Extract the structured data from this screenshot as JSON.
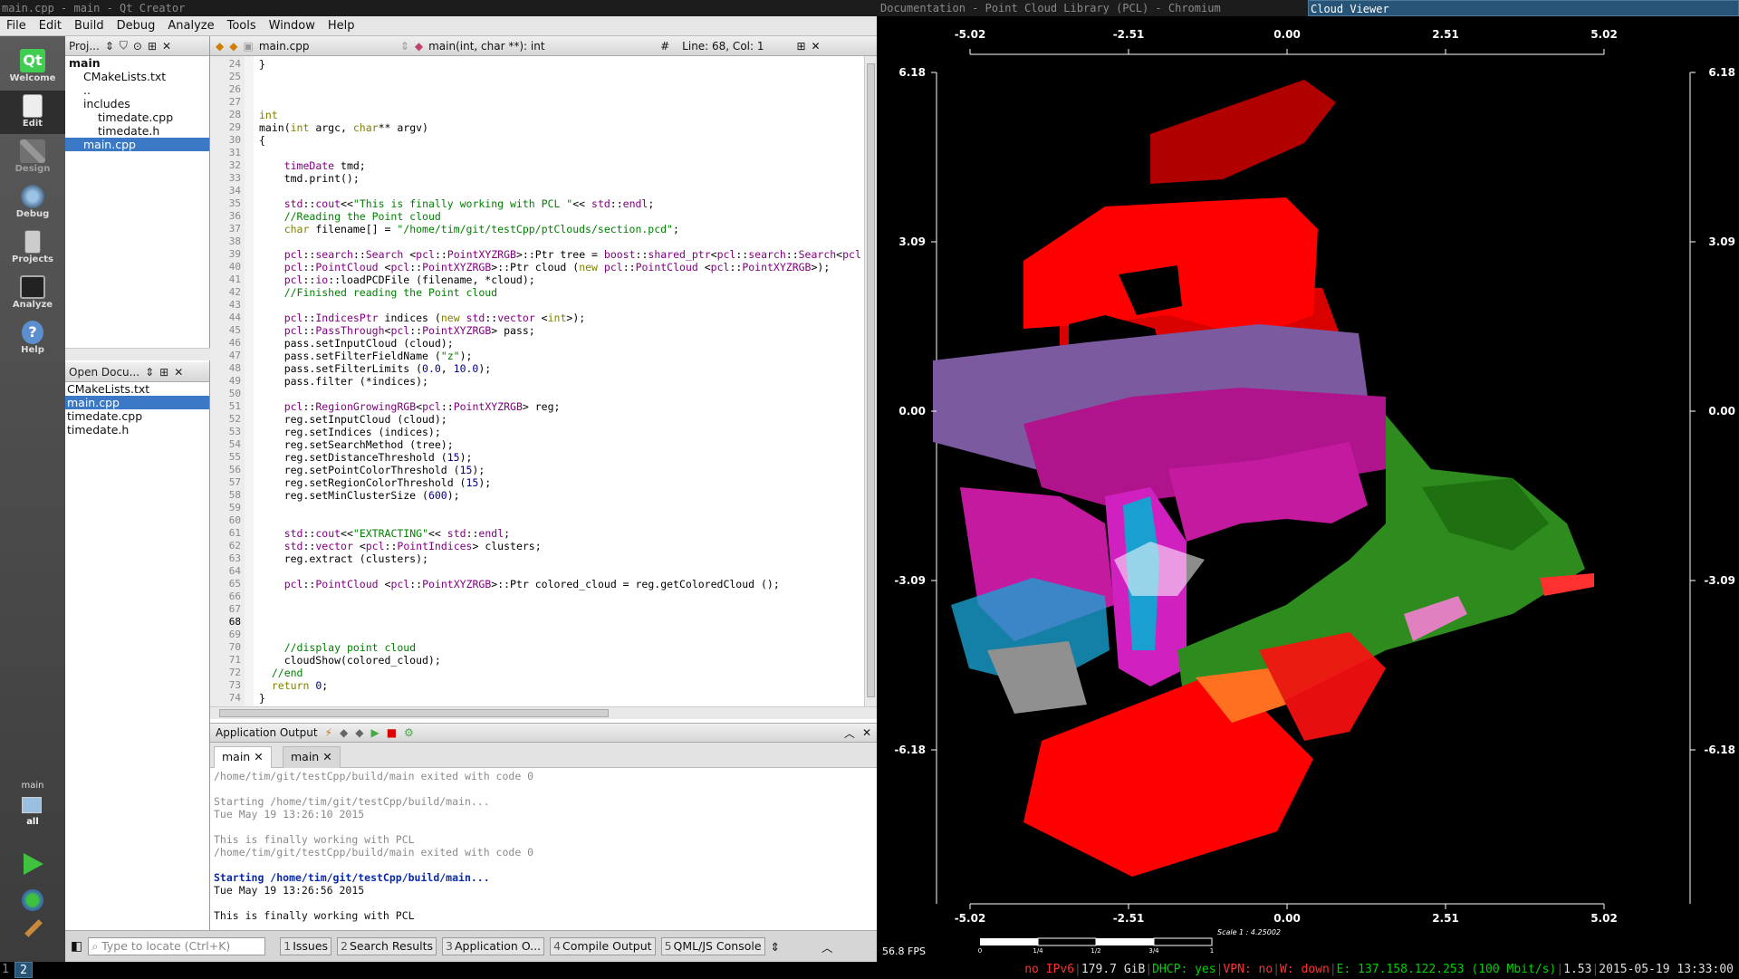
{
  "wm": {
    "title_qt": "main.cpp - main - Qt Creator",
    "title_chromium": "Documentation - Point Cloud Library (PCL) - Chromium",
    "title_viewer": "Cloud Viewer"
  },
  "menu": [
    "File",
    "Edit",
    "Build",
    "Debug",
    "Analyze",
    "Tools",
    "Window",
    "Help"
  ],
  "modes": [
    "Welcome",
    "Edit",
    "Design",
    "Debug",
    "Projects",
    "Analyze",
    "Help"
  ],
  "kit": {
    "project": "main",
    "build": "all"
  },
  "project_pane": {
    "title": "Proj...",
    "tree": [
      {
        "label": "main",
        "depth": 0,
        "bold": true
      },
      {
        "label": "CMakeLists.txt",
        "depth": 1
      },
      {
        "label": "..",
        "depth": 1
      },
      {
        "label": "includes",
        "depth": 1
      },
      {
        "label": "timedate.cpp",
        "depth": 2
      },
      {
        "label": "timedate.h",
        "depth": 2
      },
      {
        "label": "main.cpp",
        "depth": 1,
        "selected": true
      }
    ]
  },
  "open_docs": {
    "title": "Open Docu...",
    "items": [
      "CMakeLists.txt",
      "main.cpp",
      "timedate.cpp",
      "timedate.h"
    ],
    "selected": 1
  },
  "editor": {
    "file": "main.cpp",
    "symbol": "main(int, char **): int",
    "hash": "#",
    "position": "Line: 68, Col: 1",
    "line_numbers": [
      "24",
      "25",
      "26",
      "27",
      "28",
      "29",
      "30",
      "31",
      "32",
      "33",
      "34",
      "35",
      "36",
      "37",
      "38",
      "39",
      "40",
      "41",
      "42",
      "43",
      "44",
      "45",
      "46",
      "47",
      "48",
      "49",
      "50",
      "51",
      "52",
      "53",
      "54",
      "55",
      "56",
      "57",
      "58",
      "59",
      "60",
      "61",
      "62",
      "63",
      "64",
      "65",
      "66",
      "67",
      "68",
      "69",
      "70",
      "71",
      "72",
      "73",
      "74"
    ],
    "lines": [
      "}",
      "",
      "",
      "",
      "int",
      "main(int argc, char** argv)",
      "{",
      "",
      "    timeDate tmd;",
      "    tmd.print();",
      "",
      "    std::cout<<\"This is finally working with PCL \"<< std::endl;",
      "    //Reading the Point cloud",
      "    char filename[] = \"/home/tim/git/testCpp/ptClouds/section.pcd\";",
      "",
      "    pcl::search::Search <pcl::PointXYZRGB>::Ptr tree = boost::shared_ptr<pcl::search::Search<pcl",
      "    pcl::PointCloud <pcl::PointXYZRGB>::Ptr cloud (new pcl::PointCloud <pcl::PointXYZRGB>);",
      "    pcl::io::loadPCDFile (filename, *cloud);",
      "    //Finished reading the Point cloud",
      "",
      "    pcl::IndicesPtr indices (new std::vector <int>);",
      "    pcl::PassThrough<pcl::PointXYZRGB> pass;",
      "    pass.setInputCloud (cloud);",
      "    pass.setFilterFieldName (\"z\");",
      "    pass.setFilterLimits (0.0, 10.0);",
      "    pass.filter (*indices);",
      "",
      "    pcl::RegionGrowingRGB<pcl::PointXYZRGB> reg;",
      "    reg.setInputCloud (cloud);",
      "    reg.setIndices (indices);",
      "    reg.setSearchMethod (tree);",
      "    reg.setDistanceThreshold (15);",
      "    reg.setPointColorThreshold (15);",
      "    reg.setRegionColorThreshold (15);",
      "    reg.setMinClusterSize (600);",
      "",
      "",
      "    std::cout<<\"EXTRACTING\"<< std::endl;",
      "    std::vector <pcl::PointIndices> clusters;",
      "    reg.extract (clusters);",
      "",
      "    pcl::PointCloud <pcl::PointXYZRGB>::Ptr colored_cloud = reg.getColoredCloud ();",
      "",
      "",
      "",
      "",
      "    //display point cloud",
      "    cloudShow(colored_cloud);",
      "  //end",
      "  return 0;",
      "}"
    ]
  },
  "output_pane": {
    "title": "Application Output",
    "tabs": [
      "main",
      "main"
    ],
    "lines": [
      {
        "t": "/home/tim/git/testCpp/build/main exited with code 0",
        "c": "gray"
      },
      {
        "t": "",
        "c": ""
      },
      {
        "t": "Starting /home/tim/git/testCpp/build/main...",
        "c": "gray"
      },
      {
        "t": "Tue May 19 13:26:10 2015",
        "c": "gray"
      },
      {
        "t": "",
        "c": ""
      },
      {
        "t": "This is finally working with PCL",
        "c": "gray"
      },
      {
        "t": "/home/tim/git/testCpp/build/main exited with code 0",
        "c": "gray"
      },
      {
        "t": "",
        "c": ""
      },
      {
        "t": "Starting /home/tim/git/testCpp/build/main...",
        "c": "blue"
      },
      {
        "t": "Tue May 19 13:26:56 2015",
        "c": ""
      },
      {
        "t": "",
        "c": ""
      },
      {
        "t": "This is finally working with PCL",
        "c": ""
      }
    ]
  },
  "statusbar": {
    "locator_placeholder": "Type to locate (Ctrl+K)",
    "panes": [
      {
        "n": "1",
        "label": "Issues"
      },
      {
        "n": "2",
        "label": "Search Results"
      },
      {
        "n": "3",
        "label": "Application O..."
      },
      {
        "n": "4",
        "label": "Compile Output"
      },
      {
        "n": "5",
        "label": "QML/JS Console"
      }
    ]
  },
  "viewer": {
    "x_ticks": [
      "-5.02",
      "-2.51",
      "0.00",
      "2.51",
      "5.02"
    ],
    "y_ticks": [
      "6.18",
      "3.09",
      "0.00",
      "-3.09",
      "-6.18"
    ],
    "fps": "56.8 FPS",
    "scale_label": "Scale 1 : 4.25002",
    "scale_ticks": [
      "0",
      "1/4",
      "1/2",
      "3/4",
      "1"
    ]
  },
  "i3": {
    "workspaces": [
      "1",
      "2"
    ],
    "active_workspace": 1,
    "status": [
      {
        "t": "no IPv6",
        "color": "#ff3030"
      },
      {
        "t": "179.7 GiB",
        "color": "#dddddd"
      },
      {
        "t": "DHCP: yes",
        "color": "#00d000"
      },
      {
        "t": "VPN: no",
        "color": "#ff3030"
      },
      {
        "t": "W: down",
        "color": "#ff3030"
      },
      {
        "t": "E: 137.158.122.253 (100 Mbit/s)",
        "color": "#00d000"
      },
      {
        "t": "1.53",
        "color": "#dddddd"
      },
      {
        "t": "2015-05-19 13:33:00",
        "color": "#dddddd"
      }
    ]
  },
  "colors": {
    "accent": "#3b79c6",
    "i3_active": "#285577",
    "cloud_red": "#ff0000",
    "cloud_magenta": "#b0148c",
    "cloud_purple": "#7c5aa0",
    "cloud_green": "#2e8b1e",
    "cloud_cyan": "#1aa0d0"
  }
}
